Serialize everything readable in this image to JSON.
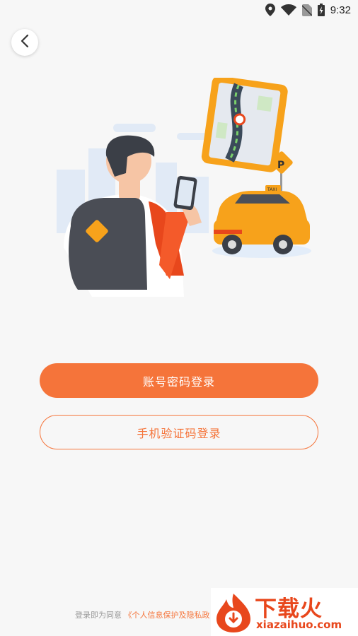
{
  "status_bar": {
    "time": "9:32",
    "icons": [
      "location-icon",
      "wifi-icon",
      "sim-absent-icon",
      "battery-charging-icon"
    ]
  },
  "header": {
    "back_icon": "chevron-left-icon"
  },
  "hero": {
    "icon": "traveler-taxi-illustration",
    "sign_text": "P",
    "taxi_text": "TAXI"
  },
  "login": {
    "password_login_label": "账号密码登录",
    "sms_login_label": "手机验证码登录"
  },
  "agreement": {
    "prefix": "登录即为同意",
    "link_text": "《个人信息保护及隐私政"
  },
  "watermark": {
    "title": "下载火",
    "subtitle": "xiazaihuo.com"
  },
  "colors": {
    "accent": "#f5743a",
    "background": "#f7f7f7",
    "watermark_red": "#e8471c"
  }
}
